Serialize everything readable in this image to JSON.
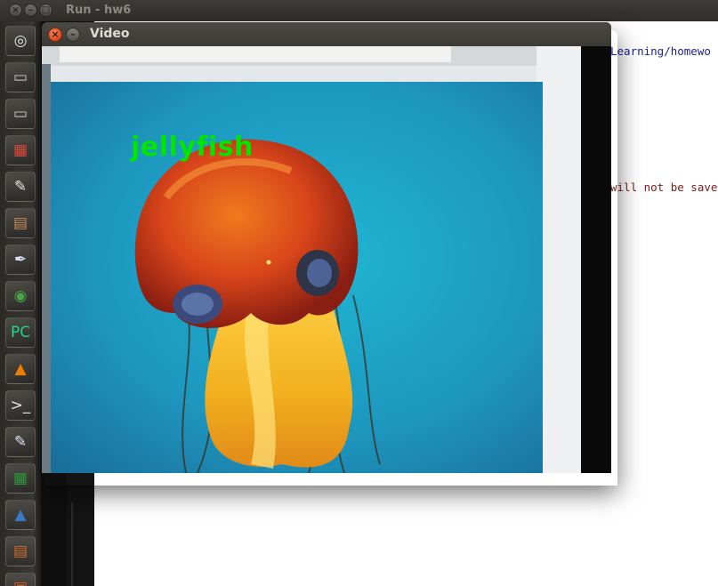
{
  "background_window": {
    "title": "Run - hw6",
    "close_glyph": "×",
    "minimize_glyph": "–",
    "maximize_glyph": "□",
    "lines": [
      "Learning/homewo",
      "will not be save"
    ]
  },
  "launcher": {
    "items": [
      {
        "name": "dash-home",
        "glyph": "◎",
        "color": "#dfe6ef"
      },
      {
        "name": "disk-drive",
        "glyph": "▭",
        "color": "#cfcfcf"
      },
      {
        "name": "disk-drive-2",
        "glyph": "▭",
        "color": "#cfcfcf"
      },
      {
        "name": "workspace-switcher",
        "glyph": "▦",
        "color": "#e04a3a"
      },
      {
        "name": "text-editor",
        "glyph": "✎",
        "color": "#e6e6e6"
      },
      {
        "name": "file-archive",
        "glyph": "▤",
        "color": "#c98c5b"
      },
      {
        "name": "inkscape",
        "glyph": "✒",
        "color": "#dfe5f3"
      },
      {
        "name": "chrome",
        "glyph": "◉",
        "color": "#4aa84a"
      },
      {
        "name": "pycharm",
        "glyph": "PC",
        "color": "#21d789"
      },
      {
        "name": "vlc",
        "glyph": "▲",
        "color": "#f08000"
      },
      {
        "name": "terminal",
        "glyph": ">_",
        "color": "#e6e6e6"
      },
      {
        "name": "libreoffice-writer",
        "glyph": "✎",
        "color": "#dfe5f3"
      },
      {
        "name": "libreoffice-calc",
        "glyph": "▦",
        "color": "#2e9b3b"
      },
      {
        "name": "libreoffice-draw",
        "glyph": "▲",
        "color": "#3c78c3"
      },
      {
        "name": "libreoffice-impress",
        "glyph": "▤",
        "color": "#d06a2b"
      },
      {
        "name": "software-center",
        "glyph": "▣",
        "color": "#d85a2b"
      }
    ]
  },
  "video_window": {
    "title": "Video",
    "close_glyph": "×",
    "minimize_glyph": "–",
    "detection_label": "jellyfish",
    "label_color": "#00e600"
  }
}
